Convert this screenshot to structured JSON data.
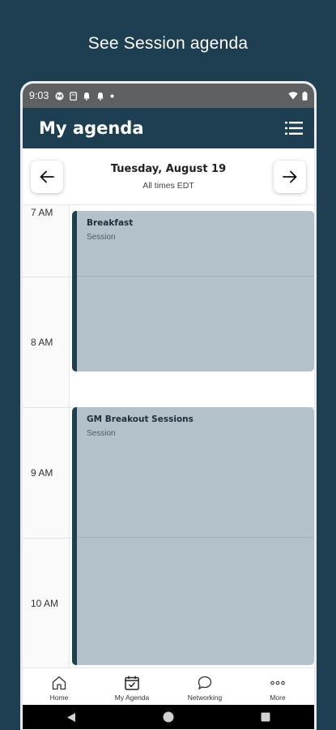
{
  "caption": "See Session agenda",
  "status_bar": {
    "time": "9:03"
  },
  "header": {
    "title": "My agenda"
  },
  "date_bar": {
    "date": "Tuesday, August 19",
    "timezone": "All times EDT"
  },
  "calendar": {
    "hours": [
      "7 AM",
      "8 AM",
      "9 AM",
      "10 AM"
    ],
    "events": [
      {
        "title": "Breakfast",
        "type": "Session"
      },
      {
        "title": "GM Breakout Sessions",
        "type": "Session"
      }
    ]
  },
  "bottom_nav": {
    "items": [
      {
        "label": "Home",
        "icon": "home-icon"
      },
      {
        "label": "My Agenda",
        "icon": "calendar-check-icon"
      },
      {
        "label": "Networking",
        "icon": "chat-bubble-icon"
      },
      {
        "label": "More",
        "icon": "more-dots-icon"
      }
    ]
  },
  "colors": {
    "brand": "#1e3f52",
    "event_fill": "#b3c2ca"
  }
}
